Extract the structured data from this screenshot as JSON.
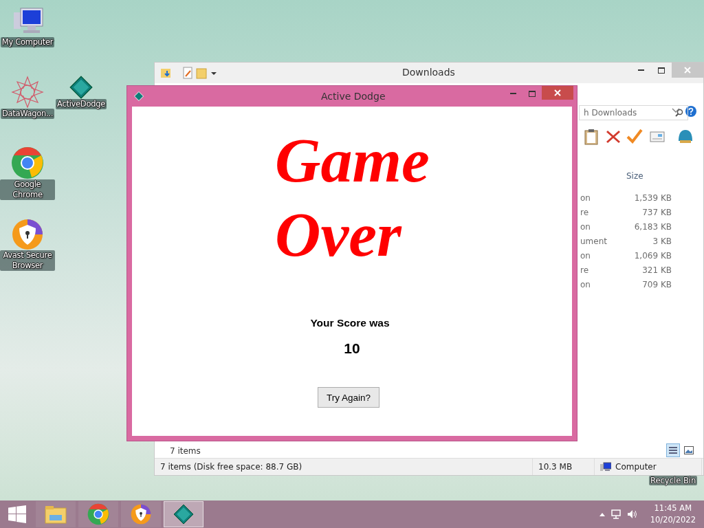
{
  "desktop_icons": [
    {
      "label": "My Computer",
      "kind": "computer"
    },
    {
      "label": "DataWagon...",
      "kind": "star"
    },
    {
      "label": "ActiveDodge",
      "kind": "gem"
    },
    {
      "label": "Google Chrome",
      "kind": "chrome"
    },
    {
      "label": "Avast Secure Browser",
      "kind": "avast"
    }
  ],
  "recycle_bin_label": "Recycle Bin",
  "explorer": {
    "title": "Downloads",
    "search_placeholder": "h Downloads",
    "size_header": "Size",
    "rows": [
      {
        "type": "on",
        "size": "1,539 KB"
      },
      {
        "type": "re",
        "size": "737 KB"
      },
      {
        "type": "on",
        "size": "6,183 KB"
      },
      {
        "type": "ument",
        "size": "3 KB"
      },
      {
        "type": "on",
        "size": "1,069 KB"
      },
      {
        "type": "re",
        "size": "321 KB"
      },
      {
        "type": "on",
        "size": "709 KB"
      }
    ],
    "item_count": "7 items",
    "status_bar": {
      "items": "7 items (Disk free space: 88.7 GB)",
      "size": "10.3 MB",
      "location": "Computer"
    }
  },
  "game": {
    "title": "Active Dodge",
    "heading": [
      "Game",
      "Over"
    ],
    "score_label": "Your Score was",
    "score": "10",
    "button": "Try Again?"
  },
  "taskbar": {
    "apps": [
      {
        "kind": "explorer",
        "selected": false
      },
      {
        "kind": "chrome",
        "selected": false
      },
      {
        "kind": "avast",
        "selected": false
      },
      {
        "kind": "gem",
        "selected": true
      }
    ],
    "time": "11:45 AM",
    "date": "10/20/2022"
  }
}
